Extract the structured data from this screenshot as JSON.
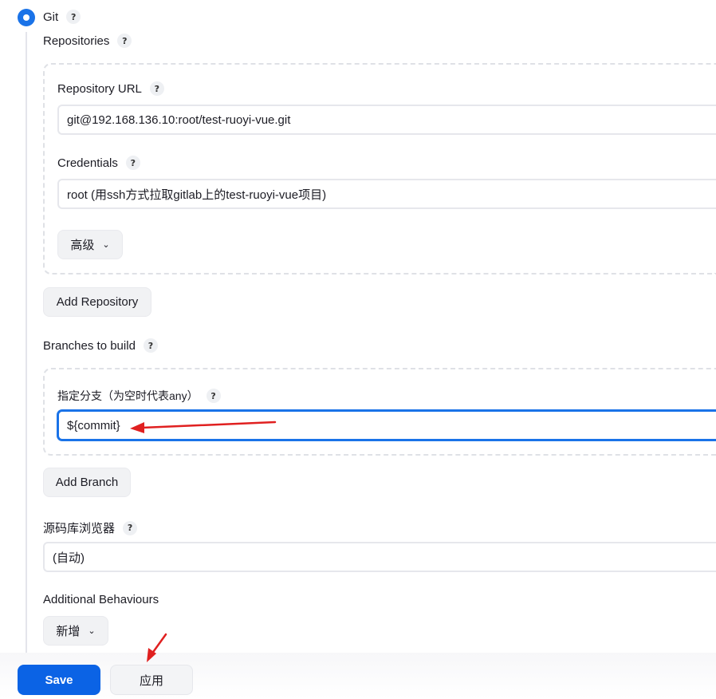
{
  "scm": {
    "option_label": "Git",
    "selected": true
  },
  "repositories": {
    "label": "Repositories",
    "repository_url_label": "Repository URL",
    "repository_url_value": "git@192.168.136.10:root/test-ruoyi-vue.git",
    "credentials_label": "Credentials",
    "credentials_value": "root (用ssh方式拉取gitlab上的test-ruoyi-vue项目)",
    "advanced_label": "高级",
    "add_repository_label": "Add Repository"
  },
  "branches": {
    "label": "Branches to build",
    "branch_specifier_label": "指定分支（为空时代表any）",
    "branch_specifier_value": "${commit}",
    "add_branch_label": "Add Branch"
  },
  "repo_browser": {
    "label": "源码库浏览器",
    "value": "(自动)"
  },
  "additional_behaviours": {
    "label": "Additional Behaviours",
    "add_label": "新增"
  },
  "footer": {
    "save_label": "Save",
    "apply_label": "应用"
  },
  "help_glyph": "?",
  "colors": {
    "accent": "#1a73e8",
    "save_button": "#0b63e5",
    "annotation_arrow": "#e02020"
  }
}
